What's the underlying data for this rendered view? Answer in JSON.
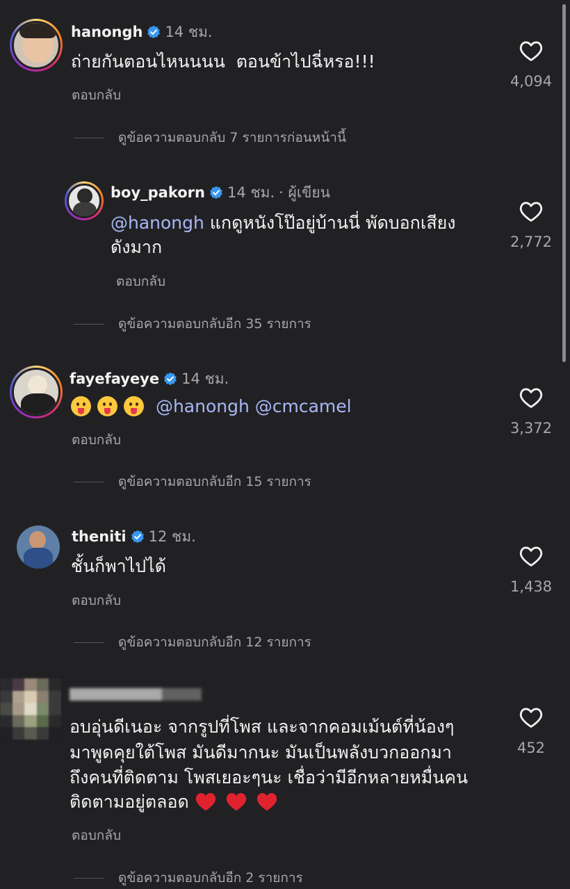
{
  "comments": [
    {
      "username": "hanongh",
      "time": "14 ชม.",
      "text": "ถ่ายกันตอนไหนนนน  ตอนข้าไปฉี่หรอ!!!",
      "reply_label": "ตอบกลับ",
      "likes": "4,094",
      "view_more": "ดูข้อความตอบกลับ 7 รายการก่อนหน้านี้"
    },
    {
      "username": "boy_pakorn",
      "time": "14 ชม.",
      "author_tag": "· ผู้เขียน",
      "mention": "@hanongh",
      "text_line1": " แกดูหนังโป๊อยู่บ้านนี่ พัดบอกเสียง",
      "text_line2": "ดังมาก",
      "reply_label": "ตอบกลับ",
      "likes": "2,772",
      "view_more": "ดูข้อความตอบกลับอีก 35 รายการ"
    },
    {
      "username": "fayefayeye",
      "time": "14 ชม.",
      "mentions": "@hanongh @cmcamel",
      "reply_label": "ตอบกลับ",
      "likes": "3,372",
      "view_more": "ดูข้อความตอบกลับอีก 15 รายการ"
    },
    {
      "username": "theniti",
      "time": "12 ชม.",
      "text": "ชั้นก็พาไปได้",
      "reply_label": "ตอบกลับ",
      "likes": "1,438",
      "view_more": "ดูข้อความตอบกลับอีก 12 รายการ"
    },
    {
      "text_line1": "อบอุ่นดีเนอะ จากรูปที่โพส และจากคอมเม้นต์ที่น้องๆ",
      "text_line2": "มาพูดคุยใต้โพส มันดีมากนะ มันเป็นพลังบวกออกมา",
      "text_line3": "ถึงคนที่ติดตาม โพสเยอะๆนะ เชื่อว่ามีอีกหลายหมื่นคน",
      "text_line4": "ติดตามอยู่ตลอด",
      "reply_label": "ตอบกลับ",
      "likes": "452",
      "view_more": "ดูข้อความตอบกลับอีก 2 รายการ"
    }
  ],
  "icons": {
    "verified": "verified-badge-icon",
    "like": "heart-outline-icon",
    "emoji": "tongue-out-emoji-icon",
    "hearts": "red-heart-icon"
  },
  "colors": {
    "background": "#212124",
    "mention": "#a9b7f5",
    "verified": "#3897f0",
    "secondary_text": "#a8a8ac"
  }
}
